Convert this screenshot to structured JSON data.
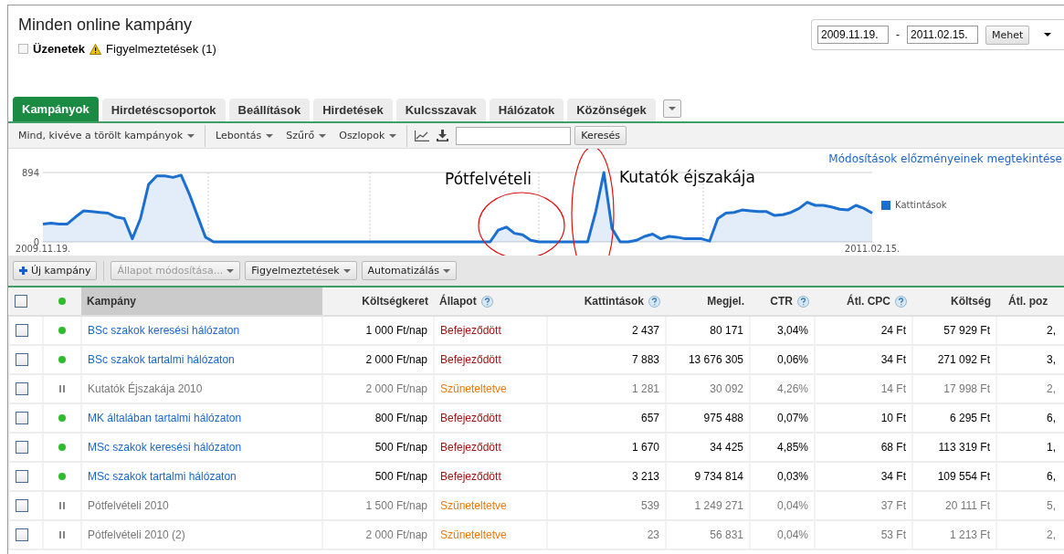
{
  "header": {
    "title": "Minden online kampány",
    "messages": "Üzenetek",
    "messages_expanded": false,
    "alerts": "Figyelmeztetések (1)"
  },
  "date_range": {
    "start": "2009.11.19.",
    "separator": "-",
    "end": "2011.02.15.",
    "go": "Mehet"
  },
  "tabs": [
    {
      "label": "Kampányok",
      "selected": true
    },
    {
      "label": "Hirdetéscsoportok",
      "selected": false
    },
    {
      "label": "Beállítások",
      "selected": false
    },
    {
      "label": "Hirdetések",
      "selected": false
    },
    {
      "label": "Kulcsszavak",
      "selected": false
    },
    {
      "label": "Hálózatok",
      "selected": false
    },
    {
      "label": "Közönségek",
      "selected": false
    }
  ],
  "toolbar": {
    "filters": [
      "Mind, kivéve a törölt kampányok",
      "Lebontás",
      "Szűrő",
      "Oszlopok"
    ],
    "search_button": "Keresés"
  },
  "chart": {
    "history_link": "Módosítások előzményeinek megtekintése",
    "chart_data": {
      "type": "area",
      "categories": [
        "2009.11.19.",
        null,
        null,
        null,
        null,
        null,
        null,
        null,
        null,
        null,
        null,
        null,
        null,
        null,
        null,
        null,
        null,
        null,
        null,
        null,
        null,
        null,
        null,
        null,
        null,
        null,
        null,
        null,
        null,
        null,
        null,
        null,
        null,
        null,
        null,
        null,
        null,
        null,
        null,
        null,
        null,
        null,
        null,
        null,
        null,
        null,
        null,
        null,
        null,
        null,
        null,
        null,
        null,
        null,
        null,
        null,
        null,
        null,
        null,
        null,
        null,
        null,
        null,
        null,
        null,
        null,
        null,
        null,
        null,
        null,
        null,
        null,
        null,
        null,
        null,
        null,
        null,
        null,
        null,
        null,
        null,
        null,
        null,
        null,
        null,
        null,
        null,
        null,
        null,
        null,
        null,
        null,
        null,
        null,
        null,
        null,
        null,
        null,
        null,
        null,
        null,
        null,
        "2011.02.15."
      ],
      "yticks": [
        0,
        894
      ],
      "ylim": [
        0,
        894
      ],
      "series": [
        {
          "name": "Kattintások",
          "color": "#1a6fd1",
          "values": [
            230,
            240,
            230,
            230,
            320,
            400,
            390,
            380,
            370,
            320,
            300,
            40,
            300,
            740,
            850,
            850,
            830,
            860,
            620,
            340,
            60,
            0,
            0,
            0,
            0,
            0,
            0,
            0,
            0,
            0,
            0,
            0,
            0,
            0,
            0,
            0,
            0,
            0,
            0,
            0,
            0,
            0,
            0,
            0,
            0,
            0,
            0,
            0,
            0,
            0,
            0,
            0,
            0,
            0,
            0,
            0,
            150,
            190,
            110,
            90,
            20,
            0,
            0,
            0,
            0,
            0,
            0,
            0,
            390,
            894,
            170,
            0,
            0,
            20,
            70,
            100,
            40,
            70,
            60,
            40,
            40,
            40,
            10,
            300,
            370,
            380,
            410,
            400,
            390,
            390,
            340,
            350,
            380,
            430,
            510,
            470,
            470,
            450,
            420,
            410,
            470,
            430,
            370
          ]
        }
      ],
      "annotations": [
        "Pótfelvételi",
        "Kutatók éjszakája"
      ]
    }
  },
  "actions": [
    {
      "label": "Új kampány",
      "kind": "new",
      "disabled": false
    },
    {
      "label": "Állapot módosítása...",
      "kind": "menu",
      "disabled": true
    },
    {
      "label": "Figyelmeztetések",
      "kind": "menu",
      "disabled": false
    },
    {
      "label": "Automatizálás",
      "kind": "menu",
      "disabled": false
    }
  ],
  "table": {
    "select_all_checked": false,
    "columns": [
      {
        "label": "Kampány",
        "help": false,
        "sorted": true
      },
      {
        "label": "Költségkeret",
        "help": false,
        "sorted": false
      },
      {
        "label": "Állapot",
        "help": true,
        "sorted": false
      },
      {
        "label": "Kattintások",
        "help": true,
        "sorted": false
      },
      {
        "label": "Megjel.",
        "help": false,
        "sorted": false
      },
      {
        "label": "CTR",
        "help": true,
        "sorted": false
      },
      {
        "label": "Átl. CPC",
        "help": true,
        "sorted": false
      },
      {
        "label": "Költség",
        "help": false,
        "sorted": false
      },
      {
        "label": "Átl. poz",
        "help": false,
        "sorted": false
      }
    ],
    "rows": [
      {
        "checked": false,
        "kind": "active",
        "cells": [
          "BSc szakok keresési hálózaton",
          "1 000 Ft/nap",
          "Befejeződött",
          "2 437",
          "80 171",
          "3,04%",
          "24 Ft",
          "57 929 Ft",
          "2,"
        ]
      },
      {
        "checked": false,
        "kind": "active",
        "cells": [
          "BSc szakok tartalmi hálózaton",
          "2 000 Ft/nap",
          "Befejeződött",
          "7 883",
          "13 676 305",
          "0,06%",
          "34 Ft",
          "271 092 Ft",
          "3,"
        ]
      },
      {
        "checked": false,
        "kind": "paused",
        "cells": [
          "Kutatók Éjszakája 2010",
          "2 000 Ft/nap",
          "Szüneteltetve",
          "1 281",
          "30 092",
          "4,26%",
          "14 Ft",
          "17 998 Ft",
          "2,"
        ]
      },
      {
        "checked": false,
        "kind": "active",
        "cells": [
          "MK általában tartalmi hálózaton",
          "800 Ft/nap",
          "Befejeződött",
          "657",
          "975 488",
          "0,07%",
          "10 Ft",
          "6 295 Ft",
          "6,"
        ]
      },
      {
        "checked": false,
        "kind": "active",
        "cells": [
          "MSc szakok keresési hálózaton",
          "500 Ft/nap",
          "Befejeződött",
          "1 670",
          "34 425",
          "4,85%",
          "68 Ft",
          "113 319 Ft",
          "1,"
        ]
      },
      {
        "checked": false,
        "kind": "active",
        "cells": [
          "MSc szakok tartalmi hálózaton",
          "500 Ft/nap",
          "Befejeződött",
          "3 213",
          "9 734 814",
          "0,03%",
          "34 Ft",
          "109 554 Ft",
          "6,"
        ]
      },
      {
        "checked": false,
        "kind": "paused",
        "cells": [
          "Pótfelvételi 2010",
          "1 500 Ft/nap",
          "Szüneteltetve",
          "539",
          "1 249 271",
          "0,04%",
          "37 Ft",
          "20 111 Ft",
          "5,"
        ]
      },
      {
        "checked": false,
        "kind": "paused",
        "cells": [
          "Pótfelvételi 2010 (2)",
          "2 000 Ft/nap",
          "Szüneteltetve",
          "23",
          "56 831",
          "0,04%",
          "53 Ft",
          "1 213 Ft",
          "2,"
        ]
      }
    ]
  }
}
